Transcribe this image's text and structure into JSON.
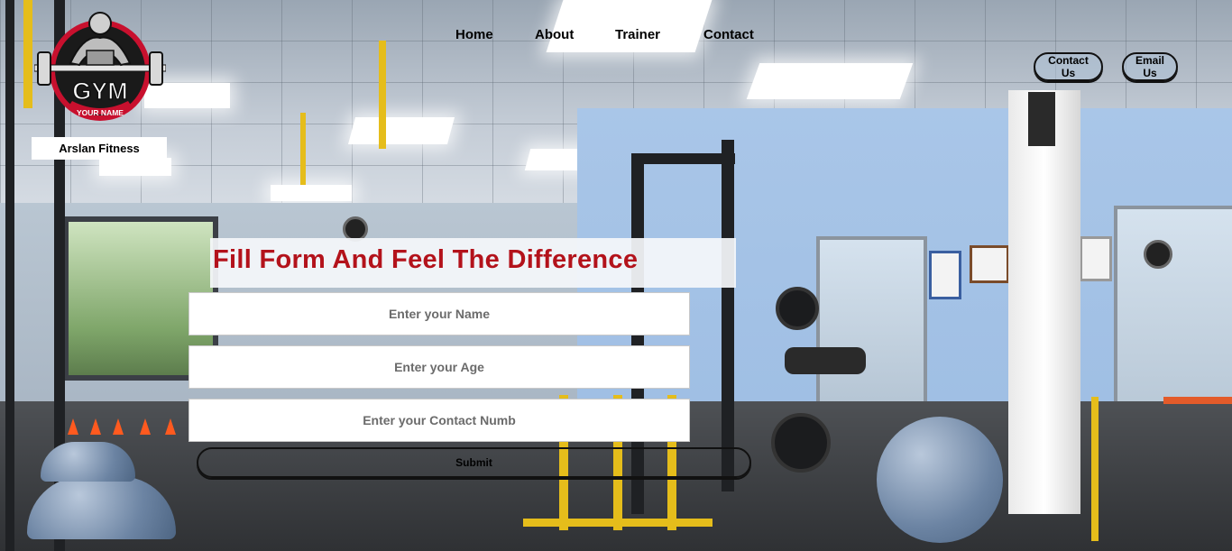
{
  "brand": {
    "logo_text": "GYM",
    "logo_subtext": "YOUR NAME",
    "name": "Arslan Fitness"
  },
  "nav": {
    "items": [
      {
        "label": "Home"
      },
      {
        "label": "About"
      },
      {
        "label": "Trainer"
      },
      {
        "label": "Contact"
      }
    ]
  },
  "header_buttons": {
    "contact_us": "Contact Us",
    "email_us": "Email Us"
  },
  "form": {
    "title": "Fill Form And Feel The Difference",
    "name_placeholder": "Enter your Name",
    "age_placeholder": "Enter your Age",
    "contact_placeholder": "Enter your Contact Numb",
    "submit_label": "Submit"
  },
  "colors": {
    "title_red": "#b3121b",
    "logo_red": "#c8102e"
  }
}
